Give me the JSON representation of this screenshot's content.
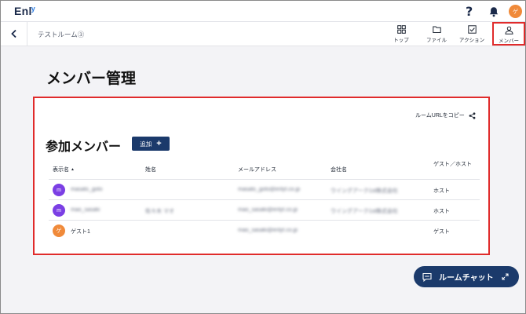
{
  "app": {
    "logo_text": "Enl",
    "logo_accent": "y"
  },
  "topbar": {
    "help_glyph": "?",
    "avatar_initial": "ゲ",
    "avatar_color": "#f08a3a"
  },
  "subbar": {
    "room_title": "テストルーム③",
    "tabs": [
      {
        "label": "トップ",
        "icon": "grid-icon"
      },
      {
        "label": "ファイル",
        "icon": "folder-icon"
      },
      {
        "label": "アクション",
        "icon": "checkbox-icon"
      },
      {
        "label": "メンバー",
        "icon": "person-icon",
        "active": true
      }
    ]
  },
  "page": {
    "title": "メンバー管理"
  },
  "members": {
    "copy_url_label": "ルームURLをコピー",
    "section_title": "参加メンバー",
    "add_label": "追加",
    "columns": [
      "表示名",
      "姓名",
      "メールアドレス",
      "会社名",
      "ゲスト／ホスト"
    ],
    "sort_indicator": "▲",
    "rows": [
      {
        "avatar": "m",
        "avatar_color": "#7b3fe4",
        "display_name": "masato_goto",
        "full_name": "",
        "email": "masato_goto@enlyt.co.jp",
        "company": "ウイングアーク1st株式会社",
        "role": "ホスト"
      },
      {
        "avatar": "m",
        "avatar_color": "#7b3fe4",
        "display_name": "mao_sasaki",
        "full_name": "佐々木 マオ",
        "email": "mao_sasaki@enlyt.co.jp",
        "company": "ウイングアーク1st株式会社",
        "role": "ホスト"
      },
      {
        "avatar": "ゲ",
        "avatar_color": "#f08a3a",
        "display_name": "ゲスト1",
        "full_name": "",
        "email": "mao_sasaki@enlyt.co.jp",
        "company": "",
        "role": "ゲスト"
      }
    ]
  },
  "chat": {
    "label": "ルームチャット"
  },
  "colors": {
    "navy": "#1b3a6b",
    "highlight": "#e02b2b"
  }
}
